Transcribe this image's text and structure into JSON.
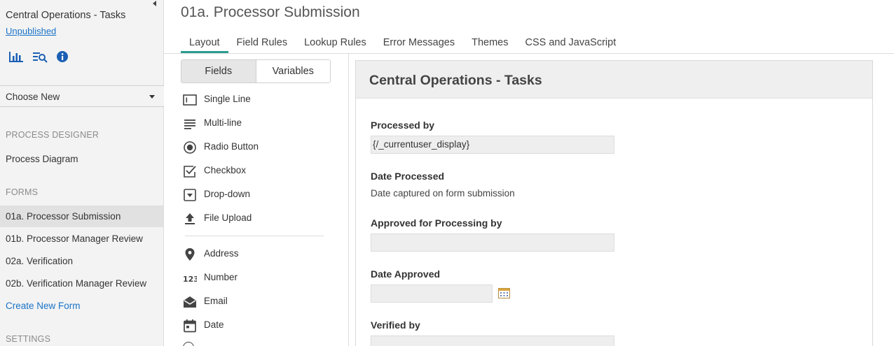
{
  "sidebar": {
    "app_title": "Central Operations - Tasks",
    "status_link": "Unpublished",
    "icons": [
      "bar-chart-icon",
      "search-list-icon",
      "info-icon"
    ],
    "choose_new": "Choose New",
    "sections": {
      "process_designer": "PROCESS DESIGNER",
      "forms": "FORMS",
      "settings": "SETTINGS"
    },
    "process_items": [
      "Process Diagram"
    ],
    "form_items": [
      "01a. Processor Submission",
      "01b. Processor Manager Review",
      "02a. Verification",
      "02b. Verification Manager Review"
    ],
    "create_new_form": "Create New Form",
    "accent": "#1a73c8"
  },
  "header": {
    "page_title": "01a. Processor Submission",
    "tabs": [
      "Layout",
      "Field Rules",
      "Lookup Rules",
      "Error Messages",
      "Themes",
      "CSS and JavaScript"
    ],
    "active_tab": "Layout",
    "active_color": "#2a9d8f"
  },
  "palette": {
    "toggle": [
      "Fields",
      "Variables"
    ],
    "items": [
      {
        "label": "Single Line",
        "icon": "single-line-icon"
      },
      {
        "label": "Multi-line",
        "icon": "multi-line-icon"
      },
      {
        "label": "Radio Button",
        "icon": "radio-button-icon"
      },
      {
        "label": "Checkbox",
        "icon": "checkbox-icon"
      },
      {
        "label": "Drop-down",
        "icon": "dropdown-icon"
      },
      {
        "label": "File Upload",
        "icon": "upload-icon"
      },
      {
        "label": "Address",
        "icon": "map-pin-icon"
      },
      {
        "label": "Number",
        "icon": "number-icon"
      },
      {
        "label": "Email",
        "icon": "email-icon"
      },
      {
        "label": "Date",
        "icon": "calendar-icon"
      }
    ]
  },
  "form": {
    "title": "Central Operations - Tasks",
    "fields": [
      {
        "label": "Processed by",
        "value": "{/_currentuser_display}"
      },
      {
        "label": "Date Processed",
        "text": "Date captured on form submission"
      },
      {
        "label": "Approved for Processing by",
        "value": ""
      },
      {
        "label": "Date Approved",
        "value": ""
      },
      {
        "label": "Verified by",
        "value": ""
      }
    ]
  }
}
